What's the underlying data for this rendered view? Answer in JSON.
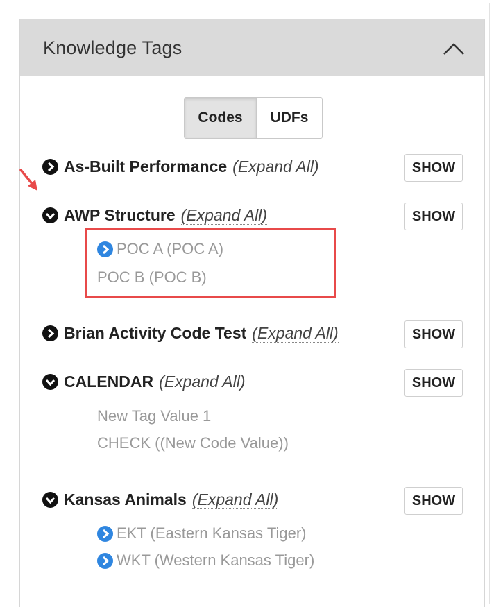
{
  "panel": {
    "title": "Knowledge Tags"
  },
  "tabs": [
    {
      "label": "Codes",
      "active": true
    },
    {
      "label": "UDFs",
      "active": false
    }
  ],
  "expand_all_label": "(Expand All)",
  "show_label": "SHOW",
  "groups": [
    {
      "label": "As-Built Performance",
      "expanded": false,
      "children": []
    },
    {
      "label": "AWP Structure",
      "expanded": true,
      "children": [
        {
          "label": "POC A (POC A)",
          "has_children": true
        },
        {
          "label": "POC B (POC B)",
          "has_children": false
        }
      ]
    },
    {
      "label": "Brian Activity Code Test",
      "expanded": false,
      "children": []
    },
    {
      "label": "CALENDAR",
      "expanded": true,
      "children": [
        {
          "label": "New Tag Value 1",
          "has_children": false
        },
        {
          "label": "CHECK ((New Code Value))",
          "has_children": false
        }
      ]
    },
    {
      "label": "Kansas Animals",
      "expanded": true,
      "children": [
        {
          "label": "EKT (Eastern Kansas Tiger)",
          "has_children": true
        },
        {
          "label": "WKT (Western Kansas Tiger)",
          "has_children": true
        }
      ]
    }
  ],
  "colors": {
    "header_bg": "#dadada",
    "annotation_red": "#e84a4a",
    "expand_icon_blue": "#2f86e0"
  }
}
